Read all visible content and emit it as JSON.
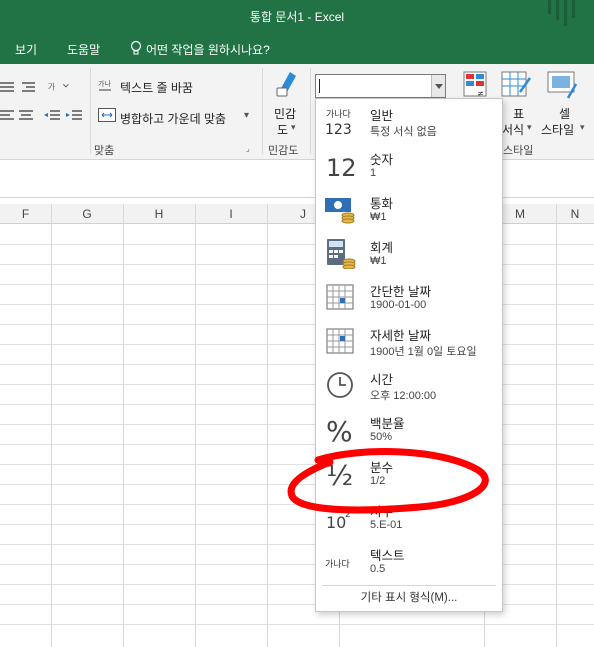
{
  "window": {
    "title": "통합 문서1  -  Excel"
  },
  "menubar": {
    "items": [
      "보기",
      "도움말"
    ],
    "tellme": "어떤 작업을 원하시나요?"
  },
  "ribbon": {
    "wrap_text": "텍스트 줄 바꿈",
    "merge_center": "병합하고 가운데 맞춤",
    "sensitivity_top": "민감",
    "sensitivity_bottom": "도",
    "align_group": "맞춤",
    "sensitivity_group": "민감도",
    "table_label": "표",
    "format_label": "서식",
    "cell_label": "셀",
    "style_label": "스타일",
    "style_group": "스타일"
  },
  "grid": {
    "columns": [
      "F",
      "G",
      "H",
      "I",
      "J",
      "M",
      "N"
    ]
  },
  "number_format": {
    "combo_value": "",
    "items": [
      {
        "icon": "general-icon",
        "label": "일반",
        "sub": "특정 서식 없음",
        "icon_text": "가나다"
      },
      {
        "icon": "number-icon",
        "label": "숫자",
        "sub": "1",
        "icon_text": "12"
      },
      {
        "icon": "currency-icon",
        "label": "통화",
        "sub": "₩1",
        "icon_text": ""
      },
      {
        "icon": "accounting-icon",
        "label": "회계",
        "sub": " ₩1",
        "icon_text": ""
      },
      {
        "icon": "short-date-icon",
        "label": "간단한 날짜",
        "sub": "1900-01-00",
        "icon_text": ""
      },
      {
        "icon": "long-date-icon",
        "label": "자세한 날짜",
        "sub": "1900년 1월 0일 토요일",
        "icon_text": ""
      },
      {
        "icon": "time-icon",
        "label": "시간",
        "sub": "오후 12:00:00",
        "icon_text": ""
      },
      {
        "icon": "percent-icon",
        "label": "백분율",
        "sub": "50%",
        "icon_text": "%"
      },
      {
        "icon": "fraction-icon",
        "label": "분수",
        "sub": " 1/2",
        "icon_text": "½"
      },
      {
        "icon": "scientific-icon",
        "label": "지수",
        "sub": "5.E-01",
        "icon_text": "10²"
      },
      {
        "icon": "text-icon",
        "label": "텍스트",
        "sub": "0.5",
        "icon_text": "가나다"
      }
    ],
    "more": "기타 표시 형식(M)..."
  },
  "colors": {
    "excel_green": "#217346",
    "annotation_red": "#ff0000"
  }
}
